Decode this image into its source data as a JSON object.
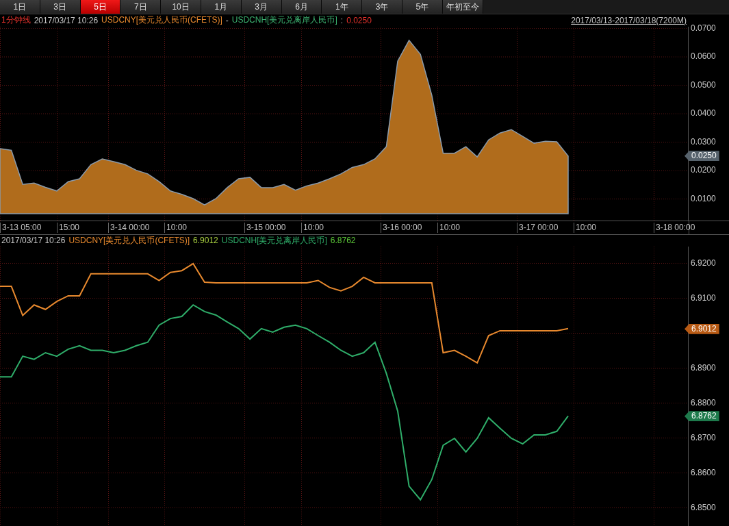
{
  "tabs": [
    {
      "label": "1日",
      "selected": false
    },
    {
      "label": "3日",
      "selected": false
    },
    {
      "label": "5日",
      "selected": true
    },
    {
      "label": "7日",
      "selected": false
    },
    {
      "label": "10日",
      "selected": false
    },
    {
      "label": "1月",
      "selected": false
    },
    {
      "label": "3月",
      "selected": false
    },
    {
      "label": "6月",
      "selected": false
    },
    {
      "label": "1年",
      "selected": false
    },
    {
      "label": "3年",
      "selected": false
    },
    {
      "label": "5年",
      "selected": false
    },
    {
      "label": "年初至今",
      "selected": false
    }
  ],
  "top_panel": {
    "info": [
      {
        "text": "1分钟线",
        "color": "#e8322c"
      },
      {
        "text": "2017/03/17 10:26",
        "color": "#c8c8c8"
      },
      {
        "text": "USDCNY[美元兑人民币(CFETS)]",
        "color": "#e8892e"
      },
      {
        "text": "-"
      },
      {
        "text": "USDCNH[美元兑离岸人民币]",
        "color": "#3cb371"
      },
      {
        "text": ":"
      },
      {
        "text": "0.0250",
        "color": "#e8322c"
      }
    ],
    "range_link": "2017/03/13-2017/03/18(7200M)",
    "badge": "0.0250",
    "chart_data": {
      "type": "area",
      "grid": true,
      "ylim": [
        0.0023,
        0.0705
      ],
      "values": [
        0.0276,
        0.027,
        0.015,
        0.0155,
        0.014,
        0.0127,
        0.016,
        0.017,
        0.022,
        0.024,
        0.023,
        0.022,
        0.02,
        0.0187,
        0.016,
        0.0127,
        0.0115,
        0.01,
        0.0078,
        0.01,
        0.0139,
        0.017,
        0.0175,
        0.0139,
        0.0139,
        0.015,
        0.013,
        0.0145,
        0.0155,
        0.017,
        0.0187,
        0.021,
        0.022,
        0.024,
        0.0283,
        0.0584,
        0.0657,
        0.0608,
        0.0464,
        0.026,
        0.026,
        0.0283,
        0.0247,
        0.0307,
        0.0331,
        0.0343,
        0.0319,
        0.0295,
        0.0302,
        0.03,
        0.025
      ],
      "yticks": [
        {
          "value": 0.01,
          "label": "0.0100"
        },
        {
          "value": 0.02,
          "label": "0.0200"
        },
        {
          "value": 0.03,
          "label": "0.0300"
        },
        {
          "value": 0.04,
          "label": "0.0400"
        },
        {
          "value": 0.05,
          "label": "0.0500"
        },
        {
          "value": 0.06,
          "label": "0.0600"
        },
        {
          "value": 0.07,
          "label": "0.0700"
        }
      ]
    },
    "time_axis": [
      "3-13 05:00",
      "15:00",
      "3-14 00:00",
      "10:00",
      "3-15 00:00",
      "10:00",
      "3-16 00:00",
      "10:00",
      "3-17 00:00",
      "10:00",
      "3-18 00:00"
    ]
  },
  "bottom_panel": {
    "info": [
      {
        "text": "2017/03/17 10:26",
        "color": "#c8c8c8"
      }
    ],
    "readings": [
      "6.9012",
      "6.8762"
    ],
    "badges": [
      "6.9012",
      "6.8762"
    ],
    "chart_data": {
      "type": "line",
      "grid": true,
      "ylim": [
        6.8447,
        6.9247
      ],
      "series": [
        {
          "name": "USDCNY[美元兑人民币(CFETS)]",
          "color": "#e8892e",
          "values": [
            6.9133,
            6.9133,
            6.905,
            6.908,
            6.9067,
            6.909,
            6.9106,
            6.9106,
            6.9169,
            6.9169,
            6.9169,
            6.9169,
            6.9169,
            6.9169,
            6.915,
            6.9173,
            6.9178,
            6.9198,
            6.9145,
            6.9143,
            6.9143,
            6.9143,
            6.9143,
            6.9143,
            6.9143,
            6.9143,
            6.9143,
            6.9143,
            6.915,
            6.913,
            6.912,
            6.9133,
            6.9159,
            6.9143,
            6.9143,
            6.9143,
            6.9143,
            6.9143,
            6.9143,
            6.8943,
            6.895,
            6.8933,
            6.8914,
            6.8992,
            6.9006,
            6.9006,
            6.9006,
            6.9006,
            6.9006,
            6.9006,
            6.9012
          ]
        },
        {
          "name": "USDCNH[美元兑离岸人民币]",
          "color": "#2fae6a",
          "values": [
            6.8874,
            6.8874,
            6.8933,
            6.8924,
            6.8943,
            6.8933,
            6.8953,
            6.8963,
            6.895,
            6.895,
            6.8943,
            6.895,
            6.8963,
            6.8973,
            6.9022,
            6.9041,
            6.9047,
            6.908,
            6.9061,
            6.9051,
            6.9031,
            6.9012,
            6.8982,
            6.9012,
            6.9002,
            6.9016,
            6.9022,
            6.9012,
            6.8992,
            6.8973,
            6.895,
            6.8933,
            6.8943,
            6.8973,
            6.8884,
            6.8776,
            6.8561,
            6.8522,
            6.858,
            6.8678,
            6.8698,
            6.8659,
            6.8698,
            6.8757,
            6.8727,
            6.8698,
            6.8682,
            6.8708,
            6.8708,
            6.8718,
            6.8762
          ]
        }
      ],
      "yticks": [
        {
          "value": 6.85,
          "label": "6.8500"
        },
        {
          "value": 6.86,
          "label": "6.8600"
        },
        {
          "value": 6.87,
          "label": "6.8700"
        },
        {
          "value": 6.88,
          "label": "6.8800"
        },
        {
          "value": 6.89,
          "label": "6.8900"
        },
        {
          "value": 6.91,
          "label": "6.9100"
        },
        {
          "value": 6.92,
          "label": "6.9200"
        }
      ]
    }
  }
}
